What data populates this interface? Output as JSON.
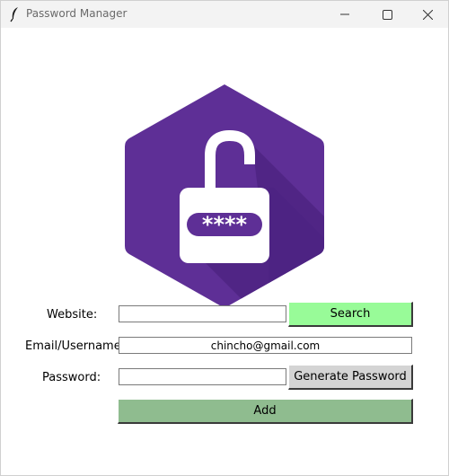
{
  "window": {
    "title": "Password Manager",
    "icons": {
      "app": "feather-icon",
      "minimize": "minimize-icon",
      "maximize": "maximize-icon",
      "close": "close-icon"
    }
  },
  "logo": {
    "icon": "padlock-password-logo",
    "mask_text": "****",
    "colors": {
      "hexagon": "#5e2f96",
      "shadow": "#4d2383",
      "lock": "#ffffff"
    }
  },
  "form": {
    "website_label": "Website:",
    "website_value": "",
    "search_label": "Search",
    "email_label": "Email/Username:",
    "email_value": "chincho@gmail.com",
    "password_label": "Password:",
    "password_value": "",
    "generate_label": "Generate Password",
    "add_label": "Add"
  },
  "colors": {
    "search_button": "#98fb98",
    "generate_button": "#d4d4d4",
    "add_button": "#8fbc8f"
  }
}
